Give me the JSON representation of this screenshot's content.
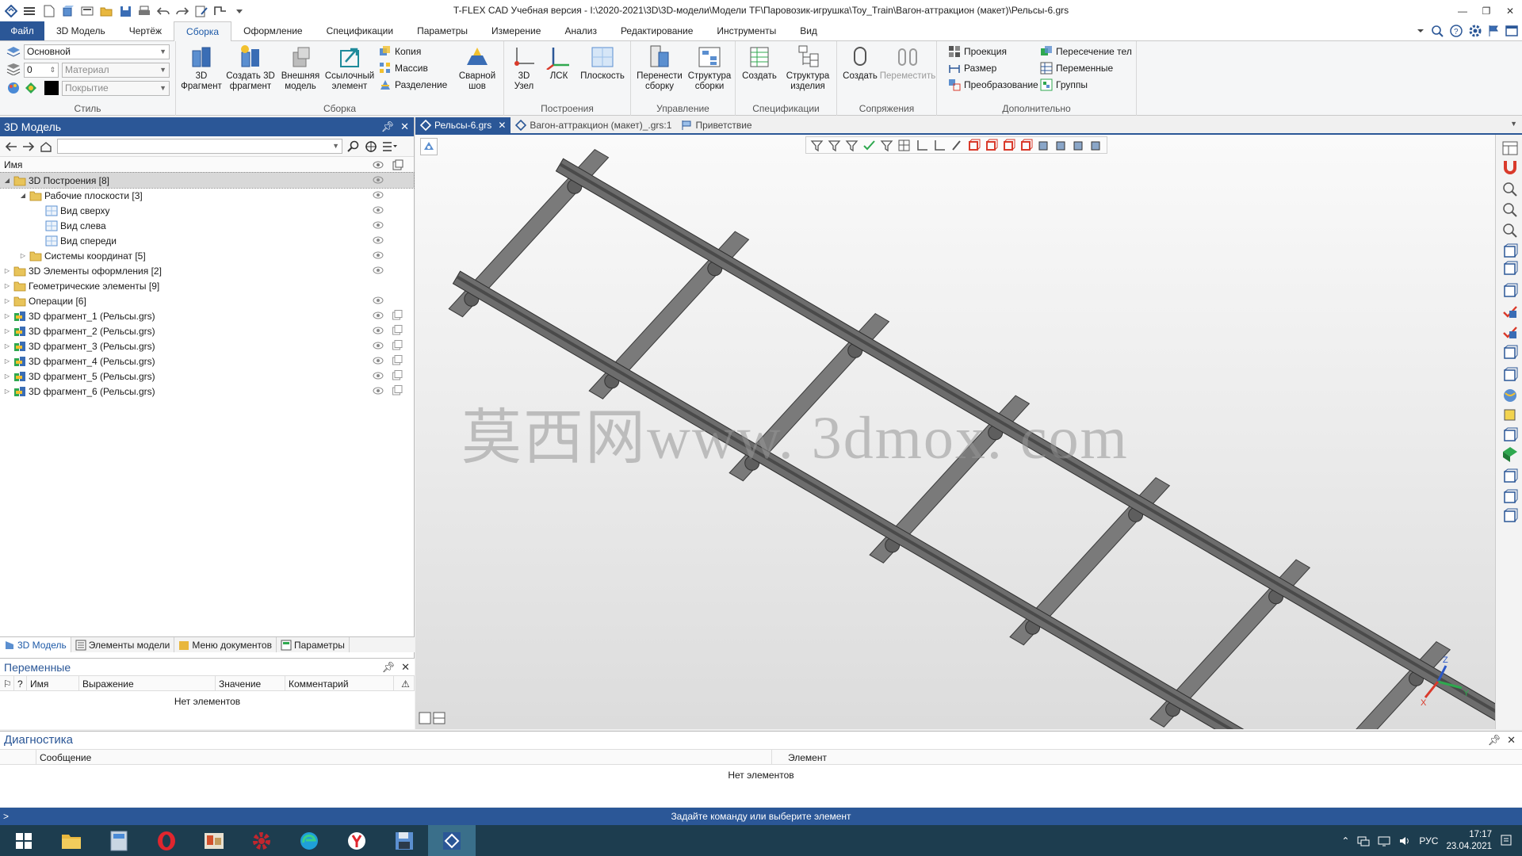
{
  "window": {
    "title": "T-FLEX CAD Учебная версия - I:\\2020-2021\\3D\\3D-модели\\Модели TF\\Паровозик-игрушка\\Toy_Train\\Вагон-аттракцион (макет)\\Рельсы-6.grs",
    "minimize": "—",
    "restore": "❐",
    "close": "✕"
  },
  "menu": {
    "tabs": [
      "Файл",
      "3D Модель",
      "Чертёж",
      "Сборка",
      "Оформление",
      "Спецификации",
      "Параметры",
      "Измерение",
      "Анализ",
      "Редактирование",
      "Инструменты",
      "Вид"
    ],
    "active_index": 3
  },
  "ribbon": {
    "style": {
      "layer": "Основной",
      "level": "0",
      "material": "Материал",
      "coating": "Покрытие",
      "label": "Стиль"
    },
    "assembly": {
      "label": "Сборка",
      "fragment": "3D\nФрагмент",
      "create_fragment": "Создать 3D\nфрагмент",
      "external_model": "Внешняя\nмодель",
      "reference_element": "Ссылочный\nэлемент",
      "copy": "Копия",
      "array": "Массив",
      "split": "Разделение",
      "weld": "Сварной\nшов"
    },
    "constructions": {
      "label": "Построения",
      "node": "3D\nУзел",
      "lcs": "ЛСК",
      "plane": "Плоскость"
    },
    "control": {
      "label": "Управление",
      "move_to_assembly": "Перенести\nсборку",
      "assembly_structure": "Структура\nсборки"
    },
    "specs": {
      "label": "Спецификации",
      "create": "Создать",
      "product_structure": "Структура\nизделия"
    },
    "mates": {
      "label": "Сопряжения",
      "create": "Создать",
      "move": "Переместить"
    },
    "extra": {
      "label": "Дополнительно",
      "projection": "Проекция",
      "size": "Размер",
      "transform": "Преобразование",
      "body_intersection": "Пересечение тел",
      "variables": "Переменные",
      "groups": "Группы"
    }
  },
  "model_panel": {
    "title": "3D Модель",
    "col_name": "Имя",
    "tree": [
      {
        "label": "3D Построения [8]",
        "level": 0,
        "expanded": true,
        "icon": "folder-icon",
        "selected": true,
        "eye": true,
        "frag": false
      },
      {
        "label": "Рабочие плоскости [3]",
        "level": 1,
        "expanded": true,
        "icon": "folder-icon",
        "selected": false,
        "eye": true,
        "frag": false
      },
      {
        "label": "Вид сверху",
        "level": 2,
        "expanded": null,
        "icon": "plane-icon",
        "selected": false,
        "eye": true,
        "frag": false
      },
      {
        "label": "Вид слева",
        "level": 2,
        "expanded": null,
        "icon": "plane-icon",
        "selected": false,
        "eye": true,
        "frag": false
      },
      {
        "label": "Вид спереди",
        "level": 2,
        "expanded": null,
        "icon": "plane-icon",
        "selected": false,
        "eye": true,
        "frag": false
      },
      {
        "label": "Системы координат [5]",
        "level": 1,
        "expanded": false,
        "icon": "folder-icon",
        "selected": false,
        "eye": true,
        "frag": false
      },
      {
        "label": "3D Элементы оформления [2]",
        "level": 0,
        "expanded": false,
        "icon": "folder-icon",
        "selected": false,
        "eye": true,
        "frag": false
      },
      {
        "label": "Геометрические элементы [9]",
        "level": 0,
        "expanded": false,
        "icon": "folder-icon",
        "selected": false,
        "eye": false,
        "frag": false
      },
      {
        "label": "Операции [6]",
        "level": 0,
        "expanded": false,
        "icon": "folder-icon",
        "selected": false,
        "eye": true,
        "frag": false
      },
      {
        "label": "3D фрагмент_1 (Рельсы.grs)",
        "level": 0,
        "expanded": false,
        "icon": "fragment-icon",
        "selected": false,
        "eye": true,
        "frag": true
      },
      {
        "label": "3D фрагмент_2 (Рельсы.grs)",
        "level": 0,
        "expanded": false,
        "icon": "fragment-icon",
        "selected": false,
        "eye": true,
        "frag": true
      },
      {
        "label": "3D фрагмент_3 (Рельсы.grs)",
        "level": 0,
        "expanded": false,
        "icon": "fragment-icon",
        "selected": false,
        "eye": true,
        "frag": true
      },
      {
        "label": "3D фрагмент_4 (Рельсы.grs)",
        "level": 0,
        "expanded": false,
        "icon": "fragment-icon",
        "selected": false,
        "eye": true,
        "frag": true
      },
      {
        "label": "3D фрагмент_5 (Рельсы.grs)",
        "level": 0,
        "expanded": false,
        "icon": "fragment-icon",
        "selected": false,
        "eye": true,
        "frag": true
      },
      {
        "label": "3D фрагмент_6 (Рельсы.grs)",
        "level": 0,
        "expanded": false,
        "icon": "fragment-icon",
        "selected": false,
        "eye": true,
        "frag": true
      }
    ],
    "bottom_tabs": [
      "3D Модель",
      "Элементы модели",
      "Меню документов",
      "Параметры"
    ]
  },
  "variables_panel": {
    "title": "Переменные",
    "columns": [
      "?",
      "Имя",
      "Выражение",
      "Значение",
      "Комментарий"
    ],
    "empty": "Нет элементов"
  },
  "doc_tabs": [
    {
      "label": "Рельсы-6.grs",
      "active": true
    },
    {
      "label": "Вагон-аттракцион (макет)_.grs:1",
      "active": false
    },
    {
      "label": "Приветствие",
      "active": false
    }
  ],
  "viewport": {
    "watermark": "莫西网www. 3dmox. com",
    "axis_z": "Z",
    "axis_x": "X",
    "axis_y": "Y"
  },
  "diagnostics": {
    "title": "Диагностика",
    "col_message": "Сообщение",
    "col_element": "Элемент",
    "empty": "Нет элементов"
  },
  "status": {
    "prompt": ">",
    "text": "Задайте команду или выберите элемент"
  },
  "taskbar": {
    "lang": "РУС",
    "time": "17:17",
    "date": "23.04.2021"
  },
  "colors": {
    "accent": "#2b5797",
    "rail": "#6d6d6d",
    "rail_dark": "#4a4a4a"
  }
}
